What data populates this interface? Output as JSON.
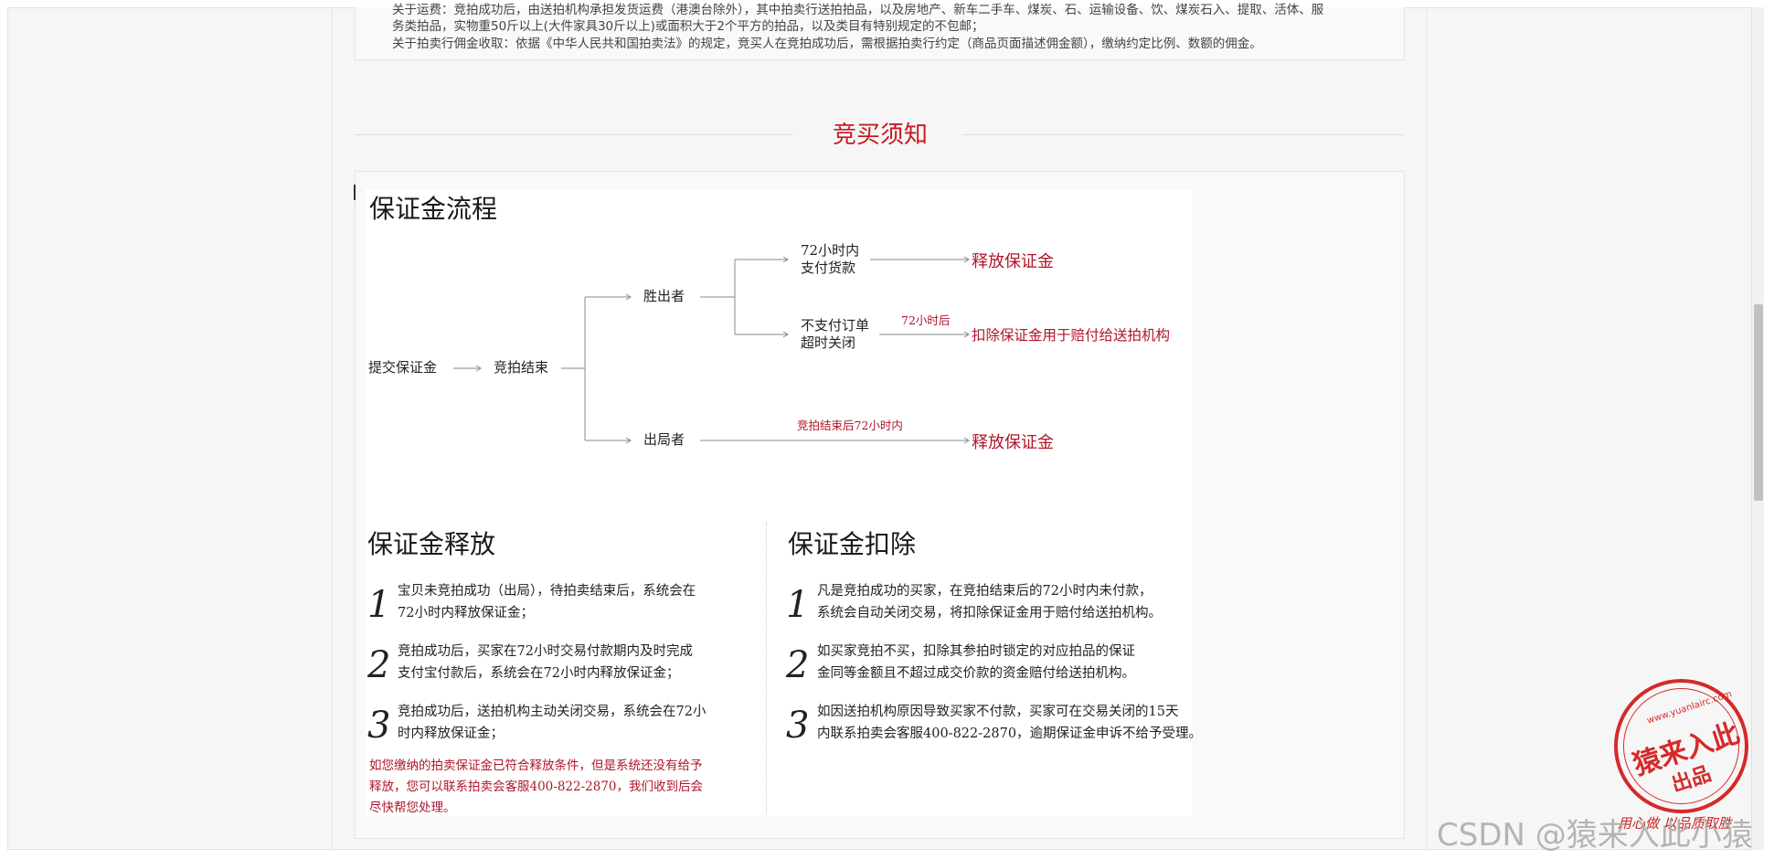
{
  "notice": {
    "line1": "关于运费：竞拍成功后，由送拍机构承担发货运费（港澳台除外），其中拍卖行送拍拍品，以及房地产、新车二手车、煤炭、石、运输设备、饮、煤炭石入、提取、活体、服",
    "line2": "务类拍品，实物重50斤以上(大件家具30斤以上)或面积大于2个平方的拍品，以及类目有特别规定的不包邮；",
    "line3": "关于拍卖行佣金收取：依据《中华人民共和国拍卖法》的规定，竞买人在竞拍成功后，需根据拍卖行约定（商品页面描述佣金额），缴纳约定比例、数额的佣金。"
  },
  "section_title": "竞买须知",
  "flow": {
    "title": "保证金流程",
    "submit": "提交保证金",
    "end": "竞拍结束",
    "winner": "胜出者",
    "loser": "出局者",
    "pay_72_line1": "72小时内",
    "pay_72_line2": "支付货款",
    "no_pay_line1": "不支付订单",
    "no_pay_line2": "超时关闭",
    "note_72": "72小时后",
    "note_end_72": "竞拍结束后72小时内",
    "release1": "释放保证金",
    "deduct": "扣除保证金用于赔付给送拍机构",
    "release2": "释放保证金"
  },
  "release": {
    "title": "保证金释放",
    "items": [
      {
        "num": "1",
        "l1": "宝贝未竞拍成功（出局），待拍卖结束后，系统会在",
        "l2": "72小时内释放保证金；"
      },
      {
        "num": "2",
        "l1": "竞拍成功后，买家在72小时交易付款期内及时完成",
        "l2": "支付宝付款后，系统会在72小时内释放保证金；"
      },
      {
        "num": "3",
        "l1": "竞拍成功后，送拍机构主动关闭交易，系统会在72小",
        "l2": "时内释放保证金；"
      }
    ],
    "note_l1": "如您缴纳的拍卖保证金已符合释放条件，但是系统还没有给予",
    "note_l2": "释放，您可以联系拍卖会客服400-822-2870，我们收到后会",
    "note_l3": "尽快帮您处理。"
  },
  "deduct": {
    "title": "保证金扣除",
    "items": [
      {
        "num": "1",
        "l1": "凡是竞拍成功的买家，在竞拍结束后的72小时内未付款，",
        "l2": "系统会自动关闭交易，将扣除保证金用于赔付给送拍机构。"
      },
      {
        "num": "2",
        "l1": "如买家竞拍不买，扣除其参拍时锁定的对应拍品的保证",
        "l2": "金同等金额且不超过成交价款的资金赔付给送拍机构。"
      },
      {
        "num": "3",
        "l1": "如因送拍机构原因导致买家不付款，买家可在交易关闭的15天",
        "l2": "内联系拍卖会客服400-822-2870，逾期保证金申诉不给予受理。"
      }
    ]
  },
  "seal": {
    "top": "www.yuanlairc.com",
    "main": "猿来入此",
    "sub": "出品",
    "slogan": "用心做 以品质取胜"
  },
  "watermark": "CSDN @猿来入此小猿",
  "colors": {
    "accent_red": "#c8191f",
    "flow_red": "#b0142a",
    "seal_red": "#d52a2a"
  }
}
